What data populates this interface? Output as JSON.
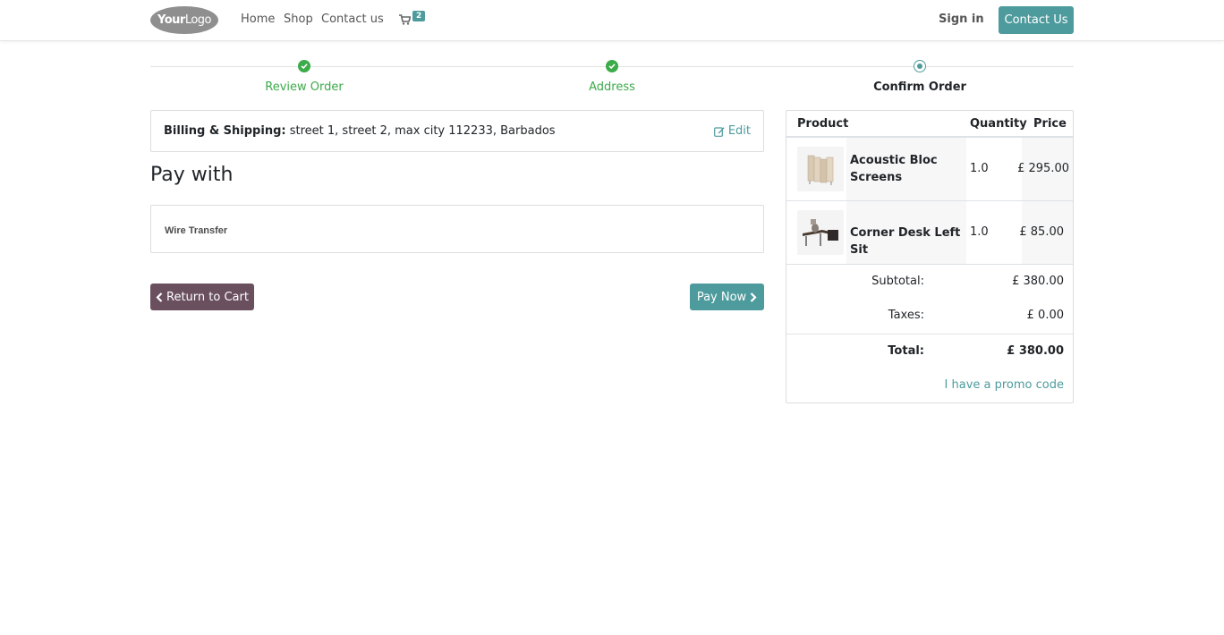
{
  "header": {
    "logo_text_bold": "Your",
    "logo_text": "Logo",
    "nav": [
      "Home",
      "Shop",
      "Contact us"
    ],
    "cart_count": "2",
    "sign_in": "Sign in",
    "contact_button": "Contact Us"
  },
  "progress": {
    "steps": [
      {
        "label": "Review Order",
        "state": "done"
      },
      {
        "label": "Address",
        "state": "done"
      },
      {
        "label": "Confirm Order",
        "state": "current"
      }
    ]
  },
  "billing": {
    "label": "Billing & Shipping:",
    "address": " street 1, street 2, max city 112233, Barbados",
    "edit": "Edit"
  },
  "payment": {
    "heading": "Pay with",
    "method": "Wire Transfer"
  },
  "actions": {
    "return_to_cart": "Return to Cart",
    "pay_now": "Pay Now"
  },
  "summary": {
    "headers": {
      "product": "Product",
      "quantity": "Quantity",
      "price": "Price"
    },
    "items": [
      {
        "name": "Acoustic Bloc Screens",
        "quantity": "1.0",
        "price": "£ 295.00"
      },
      {
        "name": "Corner Desk Left Sit",
        "quantity": "1.0",
        "price": "£ 85.00"
      }
    ],
    "subtotal_label": "Subtotal:",
    "subtotal": "£ 380.00",
    "taxes_label": "Taxes:",
    "taxes": "£ 0.00",
    "total_label": "Total:",
    "total": "£ 380.00",
    "promo": "I have a promo code"
  },
  "colors": {
    "accent": "#4e9b9d",
    "success": "#3cab49",
    "secondary_button": "#6a4f5f"
  }
}
